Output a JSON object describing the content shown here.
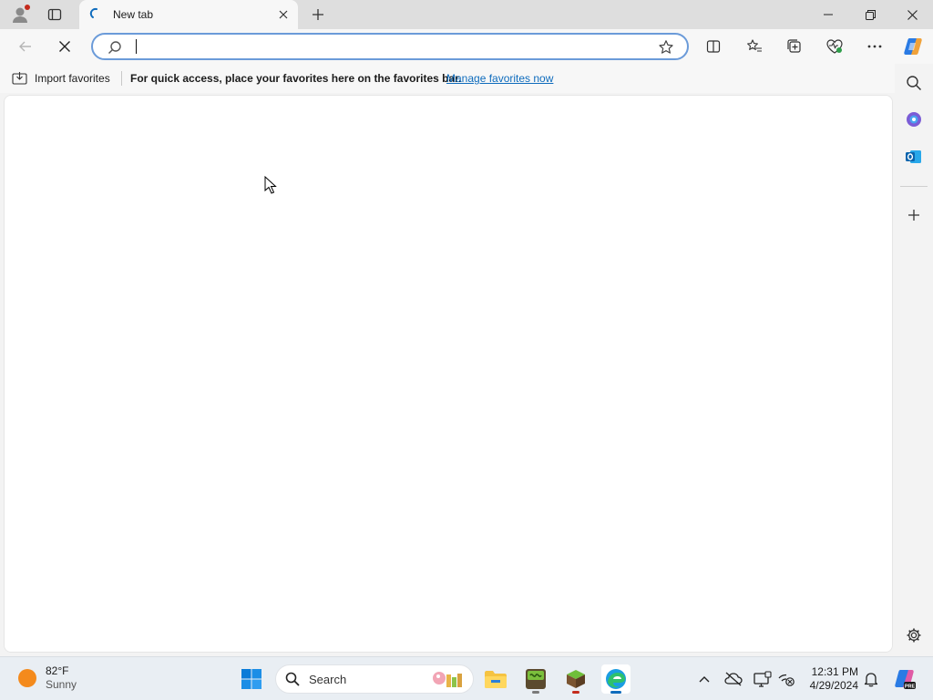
{
  "browser": {
    "tab": {
      "title": "New tab"
    },
    "address_bar": {
      "value": "",
      "placeholder": ""
    },
    "favorites_bar": {
      "import_label": "Import favorites",
      "message": "For quick access, place your favorites here on the favorites bar.",
      "manage_link": "Manage favorites now"
    }
  },
  "taskbar": {
    "weather": {
      "temp": "82°F",
      "condition": "Sunny"
    },
    "search_label": "Search",
    "clock": {
      "time": "12:31 PM",
      "date": "4/29/2024"
    }
  },
  "colors": {
    "accent": "#0f6cbd",
    "address_focus": "#6b9bd9",
    "profile_badge": "#c42b1c",
    "sun": "#f48a1c"
  }
}
